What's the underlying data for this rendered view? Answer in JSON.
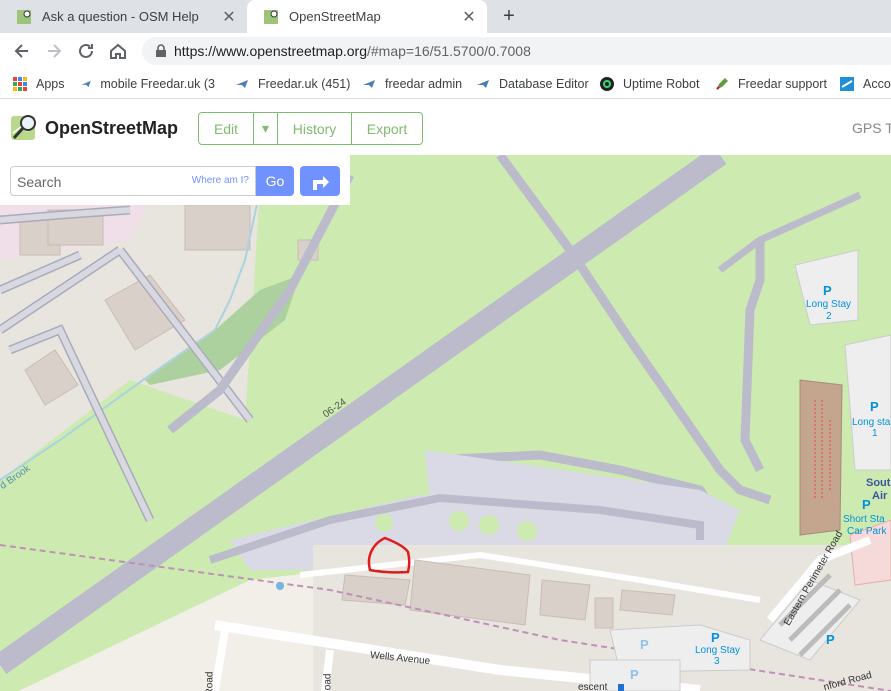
{
  "tabs": [
    {
      "title": "Ask a question - OSM Help",
      "close": "✕"
    },
    {
      "title": "OpenStreetMap",
      "close": "✕"
    }
  ],
  "newtab": "+",
  "address": {
    "host": "https://www.openstreetmap.org",
    "path": "/#map=16/51.5700/0.7008"
  },
  "bookmarks": [
    {
      "label": "Apps"
    },
    {
      "label": "mobile Freedar.uk (3"
    },
    {
      "label": "Freedar.uk (451)"
    },
    {
      "label": "freedar admin"
    },
    {
      "label": "Database Editor"
    },
    {
      "label": "Uptime Robot"
    },
    {
      "label": "Freedar support"
    },
    {
      "label": "Acco"
    }
  ],
  "osm": {
    "brand": "OpenStreetMap",
    "edit": "Edit",
    "dropdown": "▾",
    "history": "History",
    "export": "Export",
    "gps": "GPS T"
  },
  "search": {
    "placeholder": "Search",
    "where": "Where am I?",
    "go": "Go"
  },
  "map": {
    "runway": "06-24",
    "brook": "d Brook",
    "wells": "Wells Avenue",
    "eastern": "Eastern Perimeter Road",
    "crescent": "escent",
    "nford": "nford Road",
    "road_a": "Road",
    "road_b": "Road",
    "p": "P",
    "ls2a": "Long Stay",
    "ls2b": "2",
    "ls1a": "Long sta",
    "ls1b": "1",
    "ls3a": "Long Stay",
    "ls3b": "3",
    "south1": "Sout",
    "south2": "Air",
    "short1": "Short Sta",
    "short2": "Car Park"
  },
  "colors": {
    "osm_green": "#7ebc6f",
    "search_blue": "#7092ff",
    "grass": "#cdebb0",
    "runway": "#bbbbcc"
  }
}
